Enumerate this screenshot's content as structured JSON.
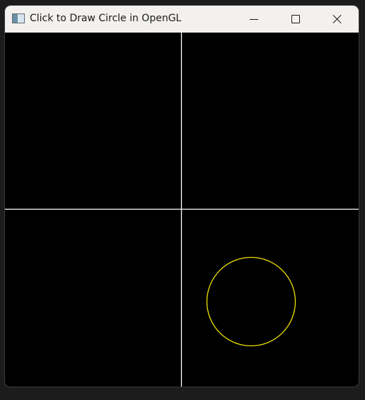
{
  "window": {
    "title": "Click to Draw Circle in OpenGL",
    "icon": "app-window-icon",
    "controls": {
      "minimize": "minimize-icon",
      "maximize": "maximize-icon",
      "close": "close-icon"
    }
  },
  "canvas": {
    "background": "#000000",
    "axis_color": "#ffffff",
    "circle_color": "#f0e000"
  }
}
